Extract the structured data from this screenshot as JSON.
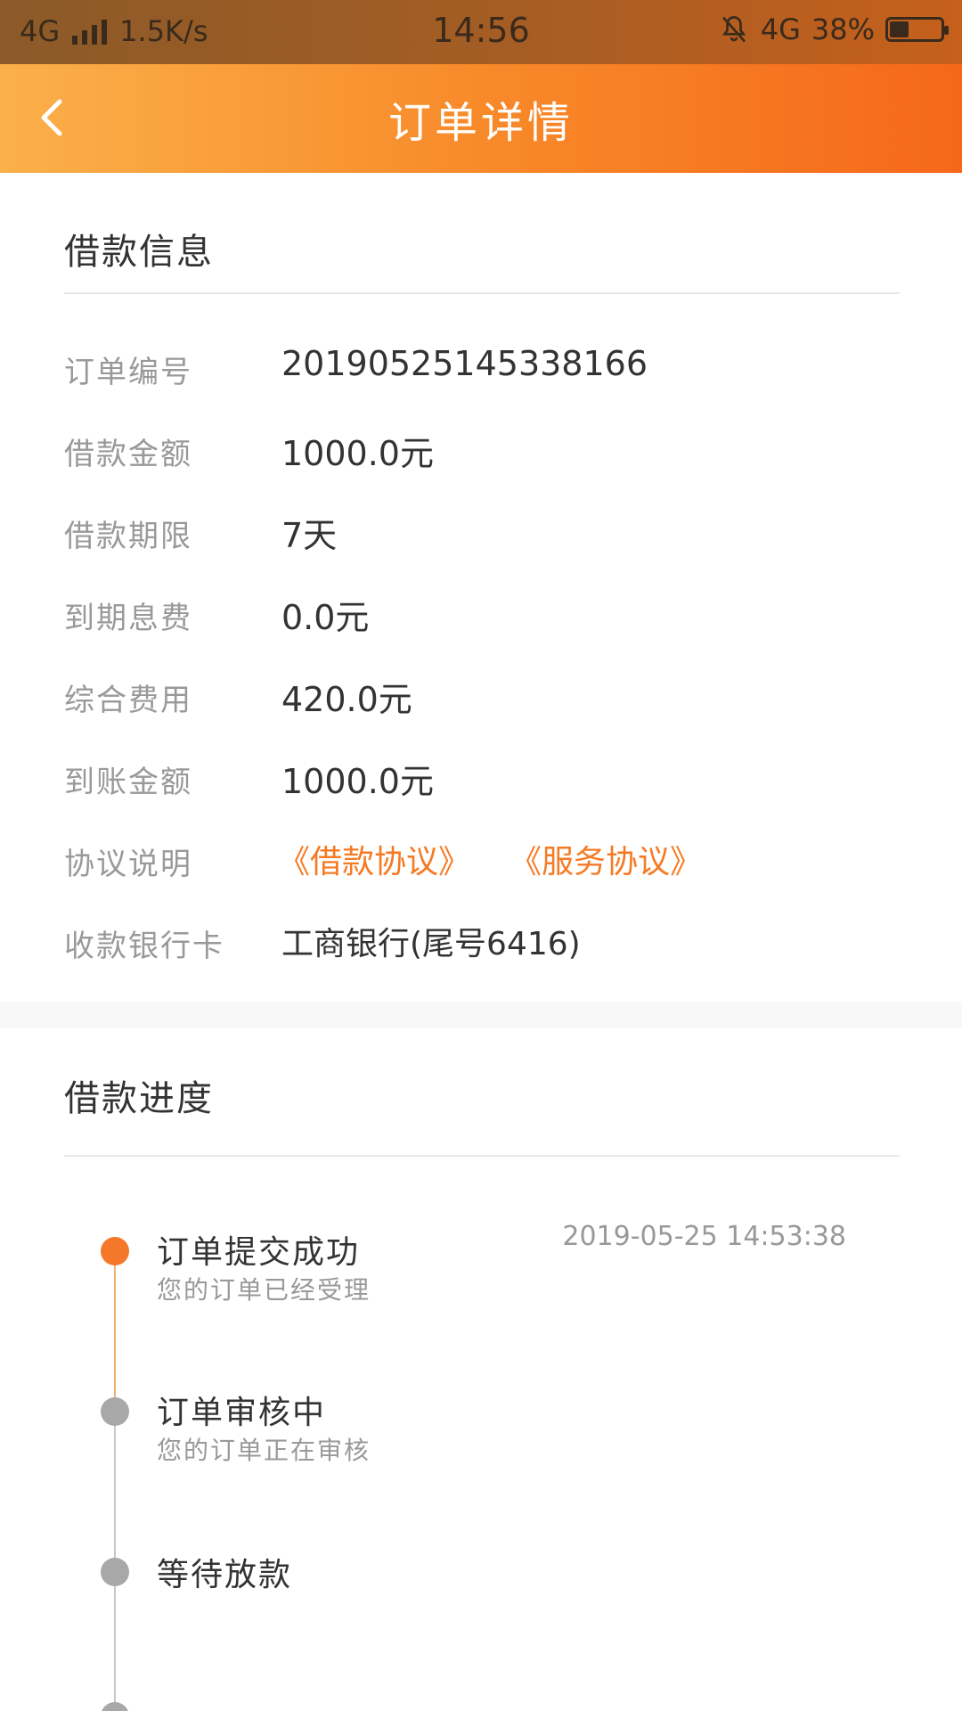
{
  "status_bar": {
    "network": "4G",
    "speed": "1.5K/s",
    "time": "14:56",
    "network_right": "4G",
    "battery": "38%",
    "battery_level": 0.38
  },
  "header": {
    "title": "订单详情"
  },
  "loan_info": {
    "section_title": "借款信息",
    "rows": [
      {
        "label": "订单编号",
        "value": "20190525145338166"
      },
      {
        "label": "借款金额",
        "value": "1000.0元"
      },
      {
        "label": "借款期限",
        "value": "7天"
      },
      {
        "label": "到期息费",
        "value": "0.0元"
      },
      {
        "label": "综合费用",
        "value": "420.0元"
      },
      {
        "label": "到账金额",
        "value": "1000.0元"
      }
    ],
    "agreement": {
      "label": "协议说明",
      "links": [
        "《借款协议》",
        "《服务协议》"
      ]
    },
    "bank": {
      "label": "收款银行卡",
      "value": "工商银行(尾号6416)"
    }
  },
  "progress": {
    "section_title": "借款进度",
    "steps": [
      {
        "title": "订单提交成功",
        "subtitle": "您的订单已经受理",
        "time": "2019-05-25 14:53:38",
        "active": true
      },
      {
        "title": "订单审核中",
        "subtitle": "您的订单正在审核",
        "time": "",
        "active": false
      },
      {
        "title": "等待放款",
        "subtitle": "",
        "time": "",
        "active": false
      }
    ]
  },
  "colors": {
    "accent": "#f57a24",
    "active_dot": "#f5782a",
    "inactive_dot": "#a8a8a8"
  }
}
